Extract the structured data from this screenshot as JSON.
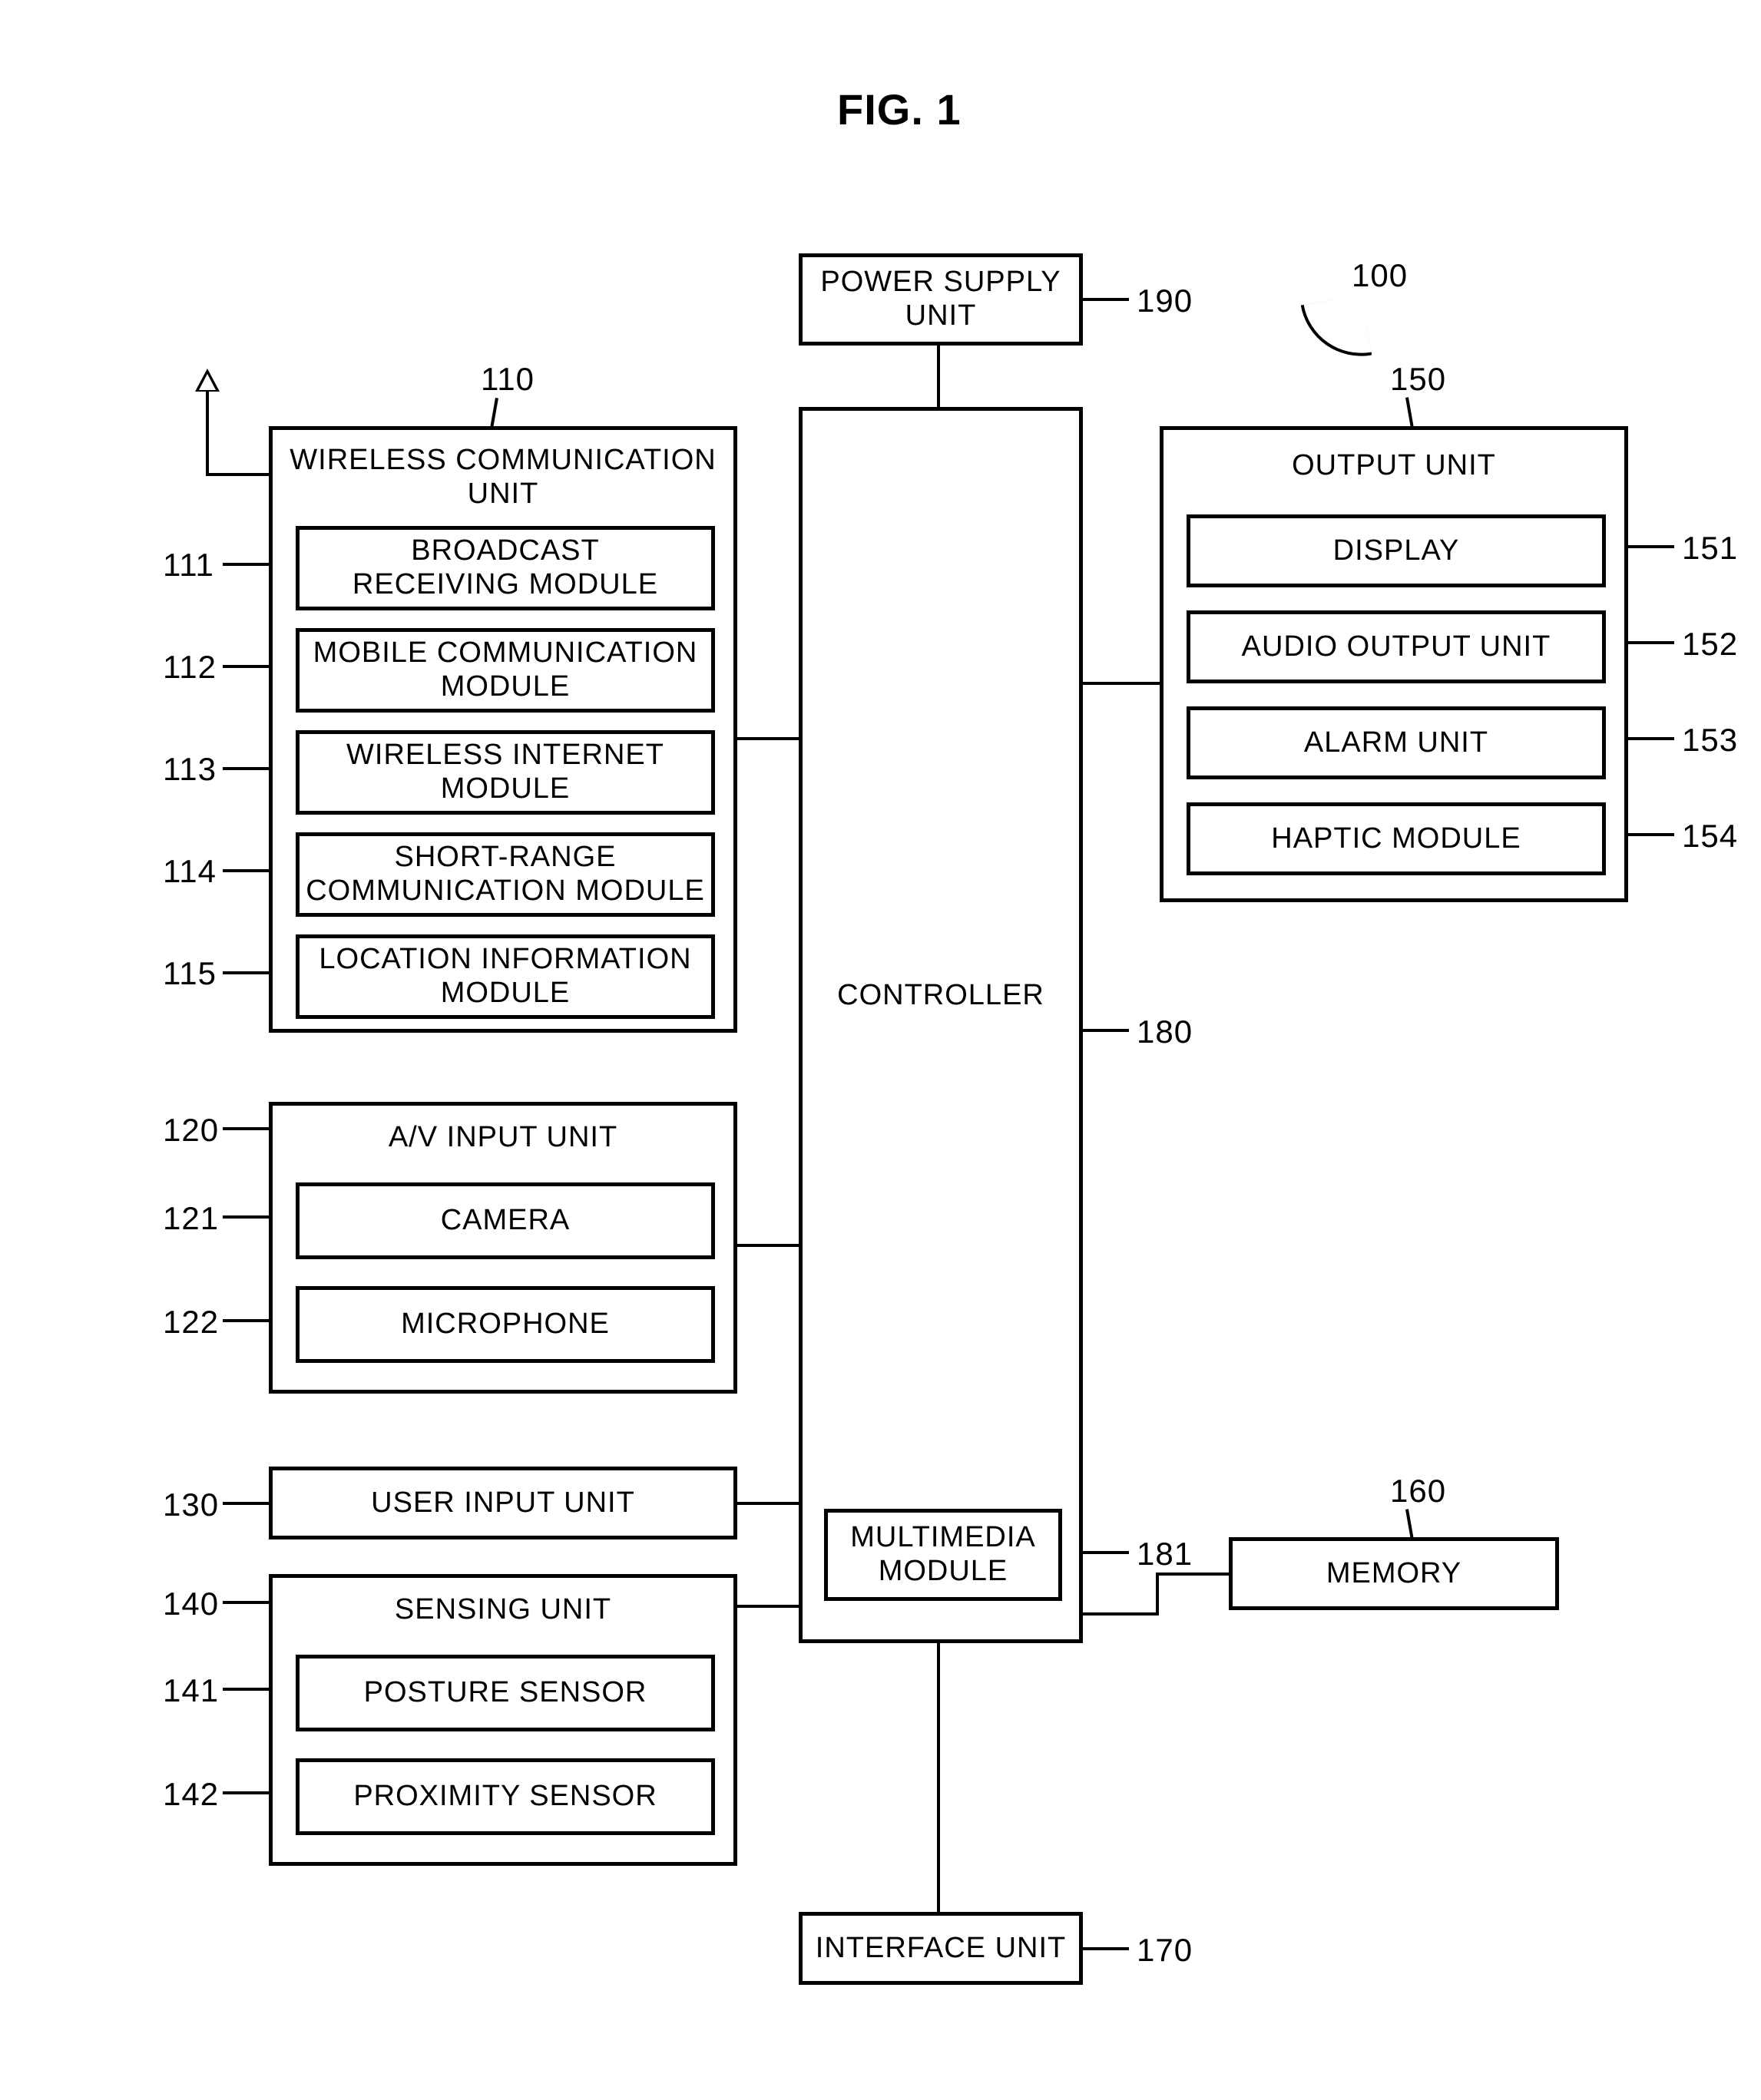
{
  "figure_title": "FIG. 1",
  "system_ref": "100",
  "controller": {
    "label": "CONTROLLER",
    "ref": "180",
    "sub": {
      "label": "MULTIMEDIA\nMODULE",
      "ref": "181"
    }
  },
  "power_supply": {
    "label": "POWER SUPPLY\nUNIT",
    "ref": "190"
  },
  "wireless": {
    "ref": "110",
    "title": "WIRELESS COMMUNICATION\nUNIT",
    "items": [
      {
        "ref": "111",
        "label": "BROADCAST\nRECEIVING MODULE"
      },
      {
        "ref": "112",
        "label": "MOBILE COMMUNICATION\nMODULE"
      },
      {
        "ref": "113",
        "label": "WIRELESS INTERNET\nMODULE"
      },
      {
        "ref": "114",
        "label": "SHORT-RANGE\nCOMMUNICATION MODULE"
      },
      {
        "ref": "115",
        "label": "LOCATION INFORMATION\nMODULE"
      }
    ]
  },
  "av_input": {
    "ref": "120",
    "title": "A/V INPUT UNIT",
    "items": [
      {
        "ref": "121",
        "label": "CAMERA"
      },
      {
        "ref": "122",
        "label": "MICROPHONE"
      }
    ]
  },
  "user_input": {
    "ref": "130",
    "label": "USER INPUT UNIT"
  },
  "sensing": {
    "ref": "140",
    "title": "SENSING UNIT",
    "items": [
      {
        "ref": "141",
        "label": "POSTURE SENSOR"
      },
      {
        "ref": "142",
        "label": "PROXIMITY SENSOR"
      }
    ]
  },
  "output": {
    "ref": "150",
    "title": "OUTPUT UNIT",
    "items": [
      {
        "ref": "151",
        "label": "DISPLAY"
      },
      {
        "ref": "152",
        "label": "AUDIO OUTPUT UNIT"
      },
      {
        "ref": "153",
        "label": "ALARM UNIT"
      },
      {
        "ref": "154",
        "label": "HAPTIC MODULE"
      }
    ]
  },
  "memory": {
    "ref": "160",
    "label": "MEMORY"
  },
  "interface": {
    "ref": "170",
    "label": "INTERFACE UNIT"
  }
}
